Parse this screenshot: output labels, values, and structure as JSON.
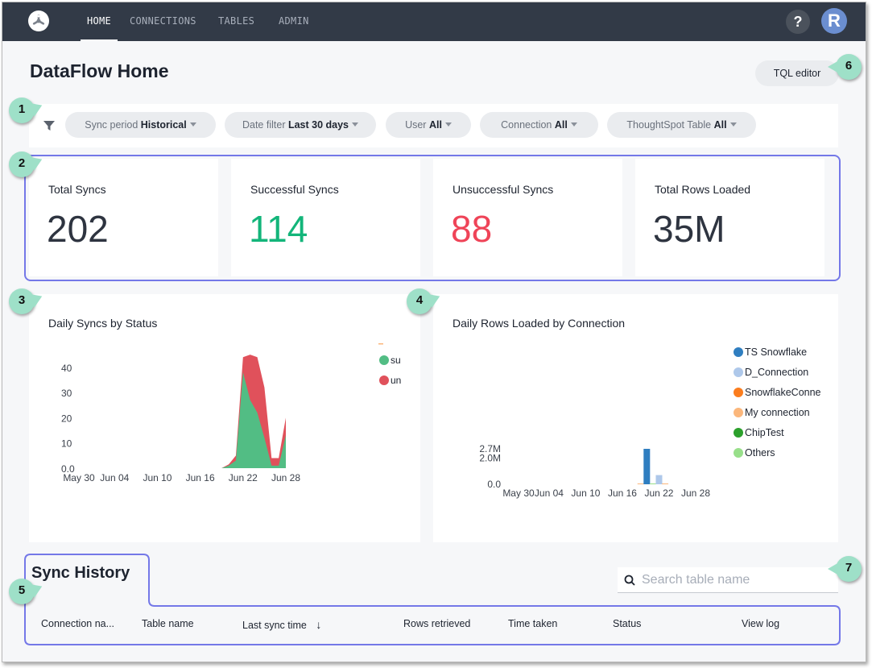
{
  "nav": {
    "logo": "dataflow-logo-icon",
    "items": [
      {
        "label": "HOME",
        "active": true
      },
      {
        "label": "CONNECTIONS",
        "active": false
      },
      {
        "label": "TABLES",
        "active": false
      },
      {
        "label": "ADMIN",
        "active": false
      }
    ],
    "help_label": "?",
    "avatar_initial": "R"
  },
  "page": {
    "title": "DataFlow Home",
    "tql_editor_label": "TQL editor"
  },
  "filters": [
    {
      "label": "Sync period",
      "value": "Historical"
    },
    {
      "label": "Date filter",
      "value": "Last 30 days"
    },
    {
      "label": "User",
      "value": "All"
    },
    {
      "label": "Connection",
      "value": "All"
    },
    {
      "label": "ThoughtSpot Table",
      "value": "All"
    }
  ],
  "kpis": [
    {
      "label": "Total Syncs",
      "value": "202",
      "color": "#2e3440"
    },
    {
      "label": "Successful Syncs",
      "value": "114",
      "color": "#13b57a"
    },
    {
      "label": "Unsuccessful Syncs",
      "value": "88",
      "color": "#ef4458"
    },
    {
      "label": "Total Rows Loaded",
      "value": "35M",
      "color": "#2e3440"
    }
  ],
  "chart_data": [
    {
      "type": "area",
      "title": "Daily Syncs by Status",
      "stacked": true,
      "x": [
        "Jun 19",
        "Jun 20",
        "Jun 21",
        "Jun 22",
        "Jun 23",
        "Jun 24",
        "Jun 25",
        "Jun 26",
        "Jun 27",
        "Jun 28"
      ],
      "x_ticks": [
        "May 30",
        "Jun 04",
        "Jun 10",
        "Jun 16",
        "Jun 22",
        "Jun 28"
      ],
      "y_ticks": [
        "0.0",
        "10",
        "20",
        "30",
        "40"
      ],
      "ylim": [
        0,
        45
      ],
      "xlim": [
        "May 30",
        "Jun 28"
      ],
      "series": [
        {
          "name": "successful",
          "legend_label": "su",
          "color": "#52bd84",
          "values": [
            0,
            1,
            3,
            38,
            27,
            22,
            12,
            1,
            1,
            13
          ]
        },
        {
          "name": "unsuccessful",
          "legend_label": "un",
          "color": "#e0515b",
          "values": [
            0,
            0.5,
            2,
            6,
            18,
            22,
            20,
            3,
            3,
            7
          ]
        }
      ],
      "legend_position": "top-right"
    },
    {
      "type": "bar",
      "title": "Daily Rows Loaded by Connection",
      "x_ticks": [
        "May 30",
        "Jun 04",
        "Jun 10",
        "Jun 16",
        "Jun 22",
        "Jun 28"
      ],
      "y_ticks": [
        "0.0",
        "2.0M",
        "2.7M"
      ],
      "ylim": [
        0,
        2.7
      ],
      "y_unit": "M",
      "xlim": [
        "May 30",
        "Jun 28"
      ],
      "bars": [
        {
          "date": "Jun 19",
          "series": "My connection",
          "value": 0.05
        },
        {
          "date": "Jun 20",
          "series": "TS Snowflake",
          "value": 2.7
        },
        {
          "date": "Jun 21",
          "series": "Others",
          "value": 0.0
        },
        {
          "date": "Jun 22",
          "series": "D_Connection",
          "value": 0.7
        },
        {
          "date": "Jun 23",
          "series": "My connection",
          "value": 0.03
        }
      ],
      "series": [
        {
          "name": "TS Snowflake",
          "color": "#2f7ec0"
        },
        {
          "name": "D_Connection",
          "color": "#aec8ea"
        },
        {
          "name": "SnowflakeConne",
          "color": "#fb7d1e"
        },
        {
          "name": "My connection",
          "color": "#fbb77c"
        },
        {
          "name": "ChipTest",
          "color": "#2ca02c"
        },
        {
          "name": "Others",
          "color": "#98df8a"
        }
      ],
      "legend_position": "right"
    }
  ],
  "sync_history": {
    "title": "Sync History",
    "search_placeholder": "Search table name",
    "search_value": "",
    "columns": [
      "Connection na...",
      "Table name",
      "Last sync time",
      "Rows retrieved",
      "Time taken",
      "Status",
      "View log"
    ],
    "sort_icon": "arrow-down-icon"
  },
  "callouts": [
    "1",
    "2",
    "3",
    "4",
    "5",
    "6",
    "7"
  ]
}
